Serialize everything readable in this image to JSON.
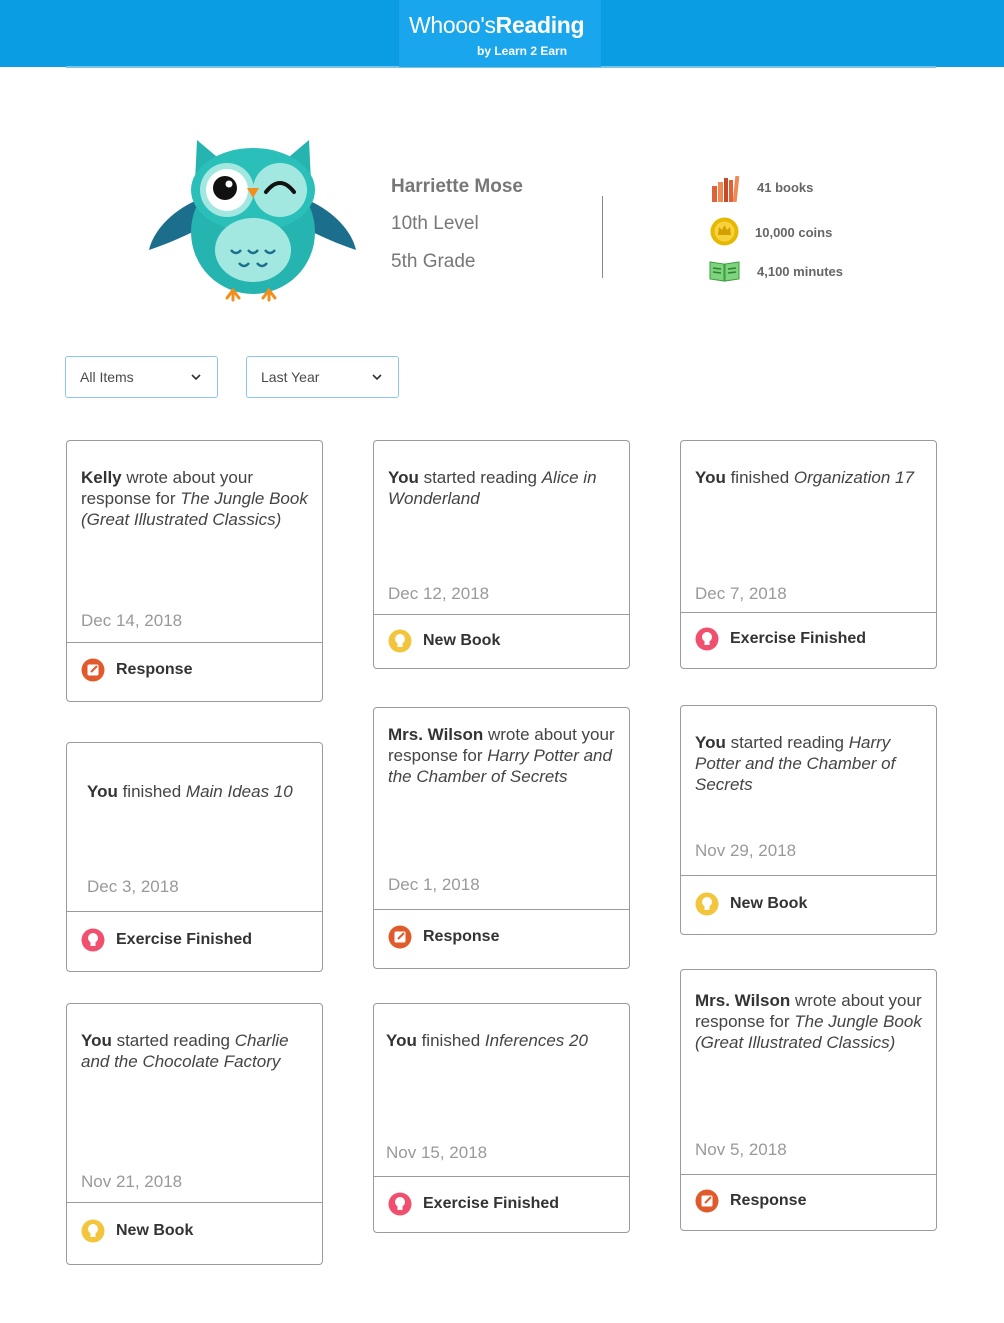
{
  "header": {
    "logo_pre": "Whooo's",
    "logo_bold": "Reading",
    "logo_sub": "by Learn 2 Earn",
    "brand_color": "#0b9de3"
  },
  "profile": {
    "name": "Harriette Mose",
    "level": "10th Level",
    "grade": "5th Grade",
    "avatar_icon": "winking-owl-icon"
  },
  "stats": {
    "books": "41 books",
    "coins": "10,000 coins",
    "minutes": "4,100 minutes"
  },
  "filters": {
    "items": "All Items",
    "period": "Last Year"
  },
  "cards": [
    {
      "actor": "Kelly",
      "action": " wrote about your response for ",
      "title": "The Jungle Book (Great Illustrated Classics)",
      "date": "Dec 14, 2018",
      "type": "Response",
      "icon": "response-icon"
    },
    {
      "actor": "You",
      "action": " started reading ",
      "title": "Alice in Wonderland",
      "date": "Dec 12, 2018",
      "type": "New Book",
      "icon": "lightbulb-icon"
    },
    {
      "actor": "You",
      "action": " finished ",
      "title": "Organization 17",
      "date": "Dec 7, 2018",
      "type": "Exercise Finished",
      "icon": "exercise-icon"
    },
    {
      "actor": "You",
      "action": " finished ",
      "title": "Main Ideas 10",
      "date": "Dec 3, 2018",
      "type": "Exercise Finished",
      "icon": "exercise-icon"
    },
    {
      "actor": "Mrs. Wilson",
      "action": " wrote about your response for ",
      "title": "Harry Potter and the Chamber of Secrets",
      "date": "Dec 1, 2018",
      "type": "Response",
      "icon": "response-icon"
    },
    {
      "actor": "You",
      "action": " started reading ",
      "title": "Harry Potter and the Chamber of Secrets",
      "date": "Nov 29, 2018",
      "type": "New Book",
      "icon": "lightbulb-icon"
    },
    {
      "actor": "You",
      "action": " started reading ",
      "title": "Charlie and the Chocolate Factory",
      "date": "Nov 21, 2018",
      "type": "New Book",
      "icon": "lightbulb-icon"
    },
    {
      "actor": "You",
      "action": " finished ",
      "title": "Inferences 20",
      "date": "Nov 15, 2018",
      "type": "Exercise Finished",
      "icon": "exercise-icon"
    },
    {
      "actor": "Mrs. Wilson",
      "action": " wrote about your response for ",
      "title": "The Jungle Book (Great Illustrated Classics)",
      "date": "Nov 5, 2018",
      "type": "Response",
      "icon": "response-icon"
    }
  ]
}
